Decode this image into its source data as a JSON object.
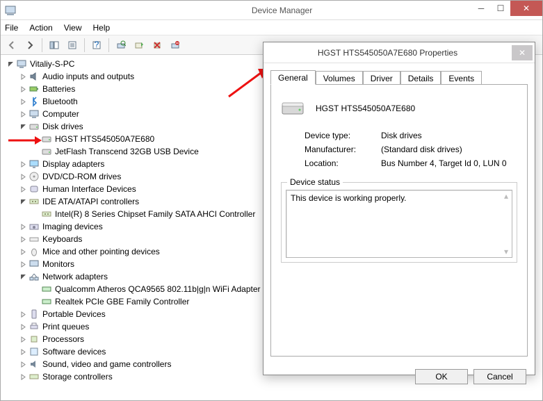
{
  "window": {
    "title": "Device Manager"
  },
  "menu": {
    "file": "File",
    "action": "Action",
    "view": "View",
    "help": "Help"
  },
  "tree": {
    "root": "Vitaliy-S-PC",
    "nodes": [
      {
        "label": "Audio inputs and outputs",
        "exp": "closed",
        "icon": "audio"
      },
      {
        "label": "Batteries",
        "exp": "closed",
        "icon": "battery"
      },
      {
        "label": "Bluetooth",
        "exp": "closed",
        "icon": "bluetooth"
      },
      {
        "label": "Computer",
        "exp": "closed",
        "icon": "computer"
      },
      {
        "label": "Disk drives",
        "exp": "open",
        "icon": "disk",
        "children": [
          {
            "label": "HGST HTS545050A7E680",
            "icon": "hdd"
          },
          {
            "label": "JetFlash Transcend 32GB USB Device",
            "icon": "hdd"
          }
        ]
      },
      {
        "label": "Display adapters",
        "exp": "closed",
        "icon": "display"
      },
      {
        "label": "DVD/CD-ROM drives",
        "exp": "closed",
        "icon": "dvd"
      },
      {
        "label": "Human Interface Devices",
        "exp": "closed",
        "icon": "hid"
      },
      {
        "label": "IDE ATA/ATAPI controllers",
        "exp": "open",
        "icon": "ide",
        "children": [
          {
            "label": "Intel(R) 8 Series Chipset Family SATA AHCI Controller",
            "icon": "ide"
          }
        ]
      },
      {
        "label": "Imaging devices",
        "exp": "closed",
        "icon": "imaging"
      },
      {
        "label": "Keyboards",
        "exp": "closed",
        "icon": "keyboard"
      },
      {
        "label": "Mice and other pointing devices",
        "exp": "closed",
        "icon": "mouse"
      },
      {
        "label": "Monitors",
        "exp": "closed",
        "icon": "monitor"
      },
      {
        "label": "Network adapters",
        "exp": "open",
        "icon": "network",
        "children": [
          {
            "label": "Qualcomm Atheros QCA9565 802.11b|g|n WiFi Adapter",
            "icon": "nic"
          },
          {
            "label": "Realtek PCIe GBE Family Controller",
            "icon": "nic"
          }
        ]
      },
      {
        "label": "Portable Devices",
        "exp": "closed",
        "icon": "portable"
      },
      {
        "label": "Print queues",
        "exp": "closed",
        "icon": "printer"
      },
      {
        "label": "Processors",
        "exp": "closed",
        "icon": "cpu"
      },
      {
        "label": "Software devices",
        "exp": "closed",
        "icon": "software"
      },
      {
        "label": "Sound, video and game controllers",
        "exp": "closed",
        "icon": "sound"
      },
      {
        "label": "Storage controllers",
        "exp": "closed",
        "icon": "storage"
      }
    ]
  },
  "dialog": {
    "title": "HGST HTS545050A7E680 Properties",
    "tabs": [
      "General",
      "Volumes",
      "Driver",
      "Details",
      "Events"
    ],
    "device_name": "HGST HTS545050A7E680",
    "labels": {
      "type": "Device type:",
      "mfr": "Manufacturer:",
      "loc": "Location:"
    },
    "values": {
      "type": "Disk drives",
      "mfr": "(Standard disk drives)",
      "loc": "Bus Number 4, Target Id 0, LUN 0"
    },
    "status_group": "Device status",
    "status_text": "This device is working properly.",
    "ok": "OK",
    "cancel": "Cancel"
  }
}
